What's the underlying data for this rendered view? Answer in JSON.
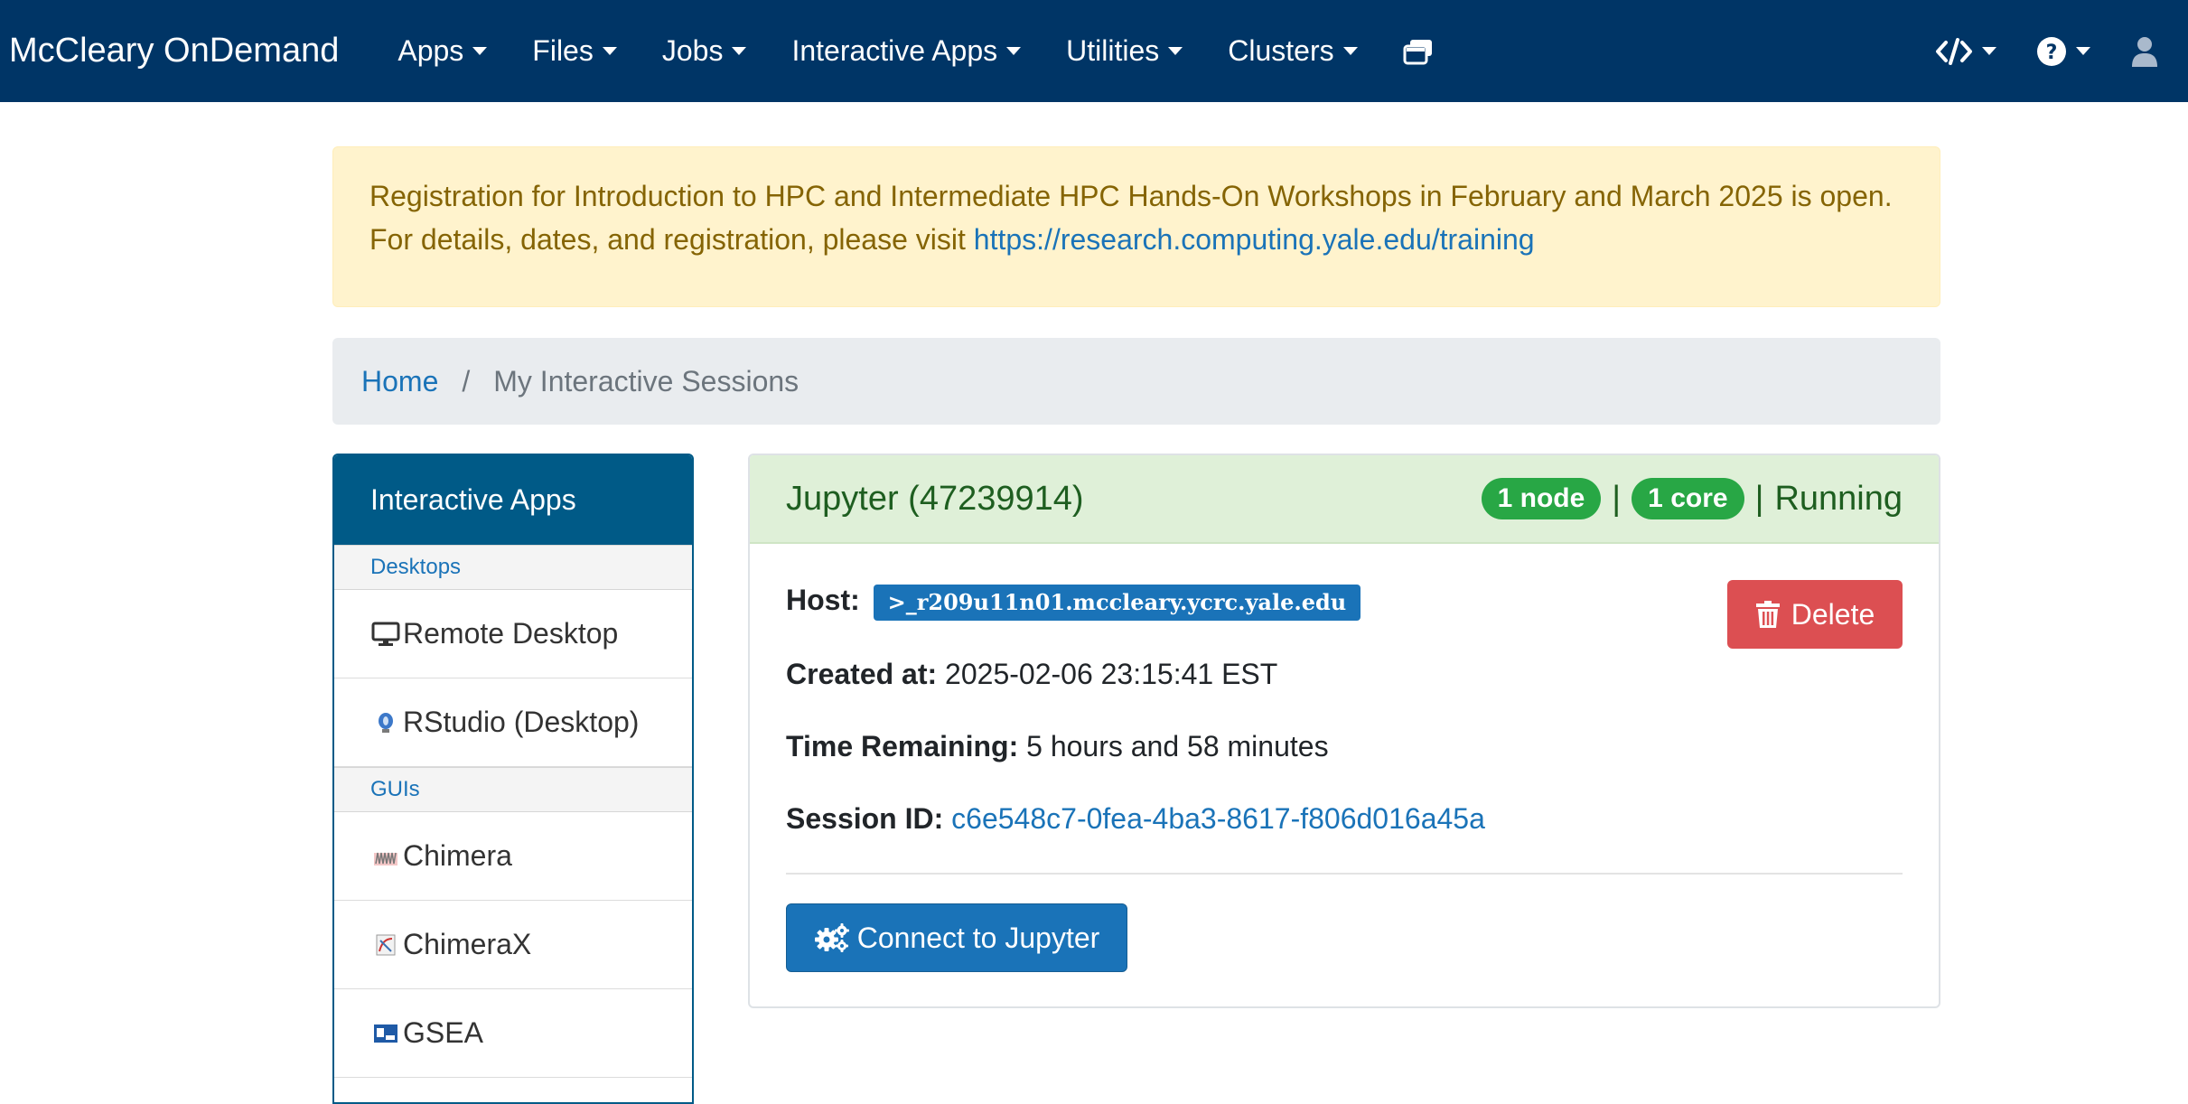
{
  "navbar": {
    "brand": "McCleary OnDemand",
    "menus": [
      "Apps",
      "Files",
      "Jobs",
      "Interactive Apps",
      "Utilities",
      "Clusters"
    ],
    "icons": [
      "windows-icon",
      "code-icon",
      "help-icon",
      "user-icon"
    ]
  },
  "alert": {
    "text": "Registration for Introduction to HPC and Intermediate HPC Hands-On Workshops in February and March 2025 is open. For details, dates, and registration, please visit ",
    "link": "https://research.computing.yale.edu/training"
  },
  "breadcrumb": {
    "home": "Home",
    "separator": "/",
    "current": "My Interactive Sessions"
  },
  "sidebar": {
    "title": "Interactive Apps",
    "sections": [
      {
        "category": "Desktops",
        "items": [
          {
            "label": "Remote Desktop",
            "icon": "monitor-icon"
          },
          {
            "label": "RStudio (Desktop)",
            "icon": "rstudio-icon"
          }
        ]
      },
      {
        "category": "GUIs",
        "items": [
          {
            "label": "Chimera",
            "icon": "chimera-icon"
          },
          {
            "label": "ChimeraX",
            "icon": "chimerax-icon"
          },
          {
            "label": "GSEA",
            "icon": "gsea-icon"
          }
        ]
      }
    ]
  },
  "session": {
    "title": "Jupyter (47239914)",
    "nodes": "1 node",
    "cores": "1 core",
    "status": "Running",
    "host_label": "Host:",
    "host": ">_r209u11n01.mccleary.ycrc.yale.edu",
    "created_label": "Created at:",
    "created": "2025-02-06 23:15:41 EST",
    "remaining_label": "Time Remaining:",
    "remaining": "5 hours and 58 minutes",
    "session_id_label": "Session ID:",
    "session_id": "c6e548c7-0fea-4ba3-8617-f806d016a45a",
    "delete_label": "Delete",
    "connect_label": "Connect to Jupyter"
  },
  "colors": {
    "navbar": "#003566",
    "sidebar_header": "#005a87",
    "link": "#1a73b8",
    "badge_green": "#28a745",
    "delete_red": "#dc4f52",
    "alert_bg": "#fff3cd"
  }
}
